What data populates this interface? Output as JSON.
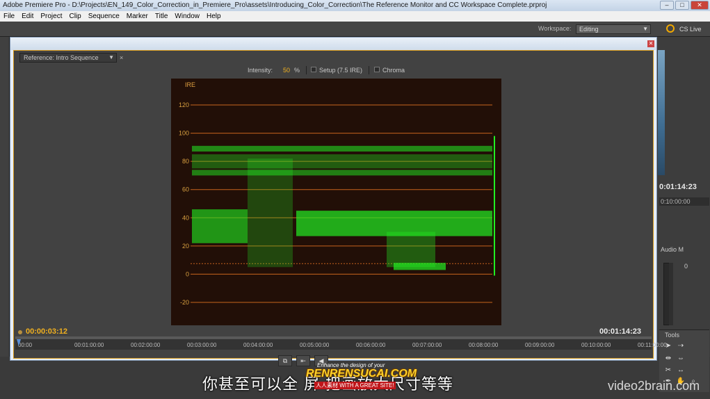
{
  "titlebar": {
    "title": "Adobe Premiere Pro - D:\\Projects\\EN_149_Color_Correction_in_Premiere_Pro\\assets\\Introducing_Color_Correction\\The Reference Monitor and CC Workspace Complete.prproj"
  },
  "menu": [
    "File",
    "Edit",
    "Project",
    "Clip",
    "Sequence",
    "Marker",
    "Title",
    "Window",
    "Help"
  ],
  "workspace": {
    "label": "Workspace:",
    "value": "Editing",
    "cs_live": "CS Live"
  },
  "reference_panel": {
    "tab": "Reference: Intro Sequence",
    "intensity_label": "Intensity:",
    "intensity_value": "50",
    "intensity_unit": "%",
    "setup_label": "Setup (7.5 IRE)",
    "chroma_label": "Chroma",
    "current_timecode": "00:00:03:12",
    "duration_timecode": "00:01:14:23"
  },
  "chart_data": {
    "type": "waveform",
    "ylabel": "IRE",
    "ylim": [
      -20,
      120
    ],
    "y_ticks": [
      120,
      100,
      80,
      60,
      40,
      20,
      0,
      -20
    ],
    "guide_levels": [
      7.5
    ],
    "trace_color": "#22ee22",
    "grid_color": "#c8641e"
  },
  "ruler": [
    "00:00",
    "00:01:00:00",
    "00:02:00:00",
    "00:03:00:00",
    "00:04:00:00",
    "00:05:00:00",
    "00:06:00:00",
    "00:07:00:00",
    "00:08:00:00",
    "00:09:00:00",
    "00:10:00:00",
    "00:11:00:00"
  ],
  "right_panel": {
    "timecode": "0:01:14:23",
    "timecode2": "0:10:00:00",
    "audio_label": "Audio M",
    "meter_zero": "0",
    "tools_label": "Tools"
  },
  "subtitle": "你甚至可以全 屏 把画放大尺寸等等",
  "watermark": {
    "line1": "Enhance the design of your",
    "line2": "RENRENSUCAI.COM",
    "line3": "人人素材 WITH A GREAT SITE!",
    "brand": "video2brain.com"
  }
}
